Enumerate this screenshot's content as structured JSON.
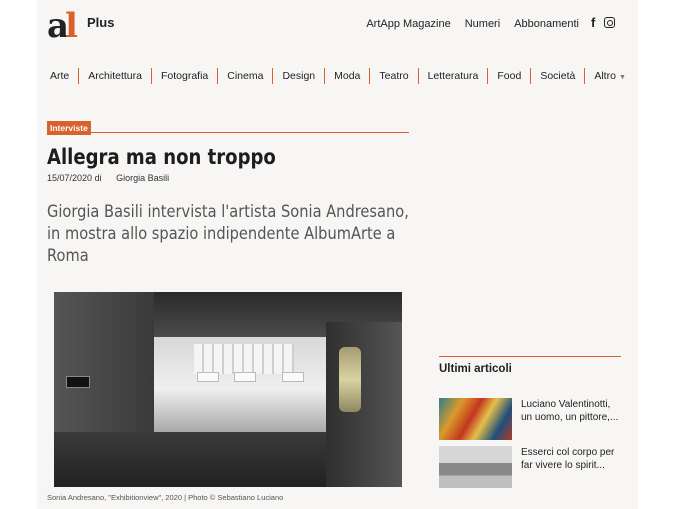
{
  "header": {
    "logo_text": "a",
    "logo_accent": "l",
    "logo_plus": "Plus",
    "links": [
      "ArtApp Magazine",
      "Numeri",
      "Abbonamenti"
    ],
    "social_icons": [
      "facebook-icon",
      "instagram-icon"
    ],
    "facebook_glyph": "f"
  },
  "nav": {
    "items": [
      "Arte",
      "Architettura",
      "Fotografia",
      "Cinema",
      "Design",
      "Moda",
      "Teatro",
      "Letteratura",
      "Food",
      "Società",
      "Altro"
    ],
    "accent_color": "#d8622d"
  },
  "article": {
    "category": "Interviste",
    "title": "Allegra ma non troppo",
    "date": "15/07/2020",
    "by": "di",
    "author": "Giorgia Basili",
    "subtitle": "Giorgia Basili intervista l'artista Sonia Andresano, in mostra allo spazio indipendente  AlbumArte a Roma",
    "caption": "Sonia Andresano, \"Exhibitionview\", 2020 | Photo © Sebastiano Luciano"
  },
  "sidebar": {
    "title": "Ultimi articoli",
    "items": [
      {
        "text": "Luciano Valentinotti, un uomo, un pittore,..."
      },
      {
        "text": "Esserci col corpo per far vivere lo spirit..."
      }
    ]
  }
}
